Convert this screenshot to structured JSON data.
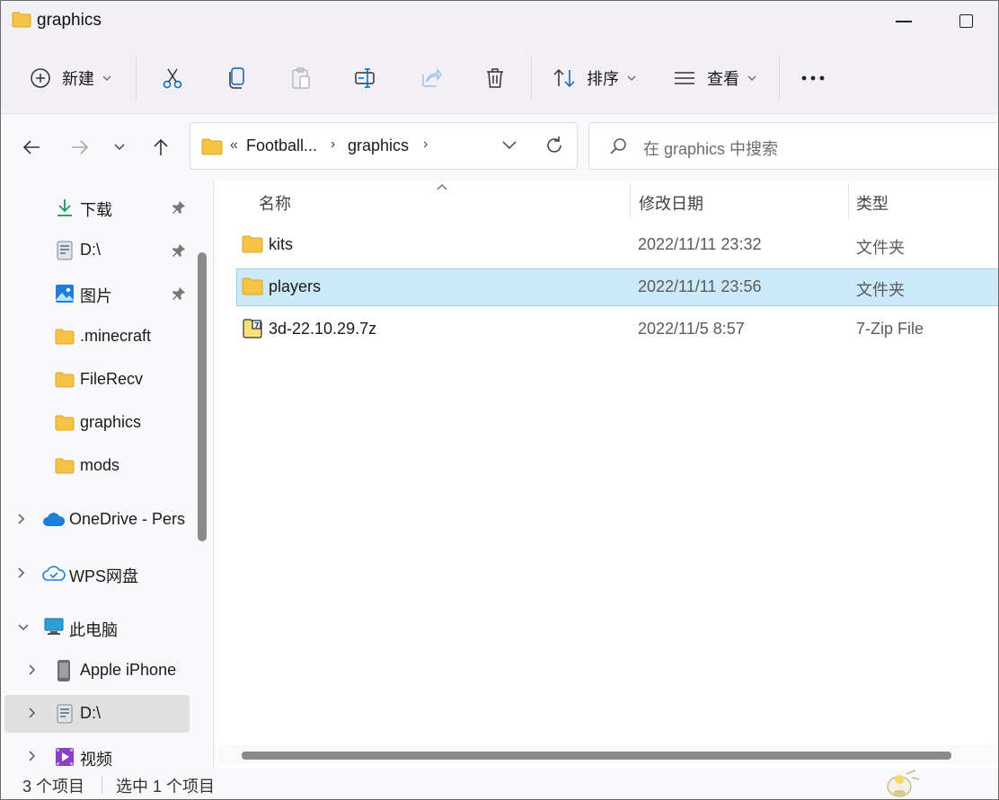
{
  "window": {
    "title": "graphics"
  },
  "toolbar": {
    "new_label": "新建",
    "sort_label": "排序",
    "view_label": "查看",
    "more_label": "···"
  },
  "address": {
    "overflow": "«",
    "crumbs": [
      "Football...",
      "graphics"
    ],
    "separator": "›"
  },
  "search": {
    "placeholder": "在 graphics 中搜索"
  },
  "sidebar": {
    "items": [
      {
        "label": "下载",
        "icon": "download-icon",
        "pinned": true
      },
      {
        "label": "D:\\",
        "icon": "drive-icon",
        "pinned": true
      },
      {
        "label": "图片",
        "icon": "pictures-icon",
        "pinned": true
      },
      {
        "label": ".minecraft",
        "icon": "folder-icon"
      },
      {
        "label": "FileRecv",
        "icon": "folder-icon"
      },
      {
        "label": "graphics",
        "icon": "folder-icon"
      },
      {
        "label": "mods",
        "icon": "folder-icon"
      },
      {
        "label": "OneDrive - Pers",
        "icon": "cloud-icon",
        "expandable": true
      },
      {
        "label": "WPS网盘",
        "icon": "wps-cloud-icon",
        "expandable": true
      },
      {
        "label": "此电脑",
        "icon": "pc-icon",
        "expanded": true
      },
      {
        "label": "Apple iPhone",
        "icon": "phone-icon",
        "expandable": true
      },
      {
        "label": "D:\\",
        "icon": "drive-icon",
        "expandable": true,
        "selected": true
      },
      {
        "label": "视频",
        "icon": "video-icon",
        "expandable": true
      }
    ]
  },
  "columns": {
    "name": "名称",
    "date": "修改日期",
    "type": "类型"
  },
  "files": [
    {
      "name": "kits",
      "date": "2022/11/11 23:32",
      "type": "文件夹",
      "icon": "folder-icon"
    },
    {
      "name": "players",
      "date": "2022/11/11 23:56",
      "type": "文件夹",
      "icon": "folder-icon",
      "selected": true
    },
    {
      "name": "3d-22.10.29.7z",
      "date": "2022/11/5 8:57",
      "type": "7-Zip File",
      "icon": "archive-icon"
    }
  ],
  "status": {
    "count": "3 个项目",
    "selection": "选中 1 个项目"
  },
  "colors": {
    "selection_bg": "#cce8fb",
    "folder": "#f6c444",
    "accent": "#0067c0"
  }
}
